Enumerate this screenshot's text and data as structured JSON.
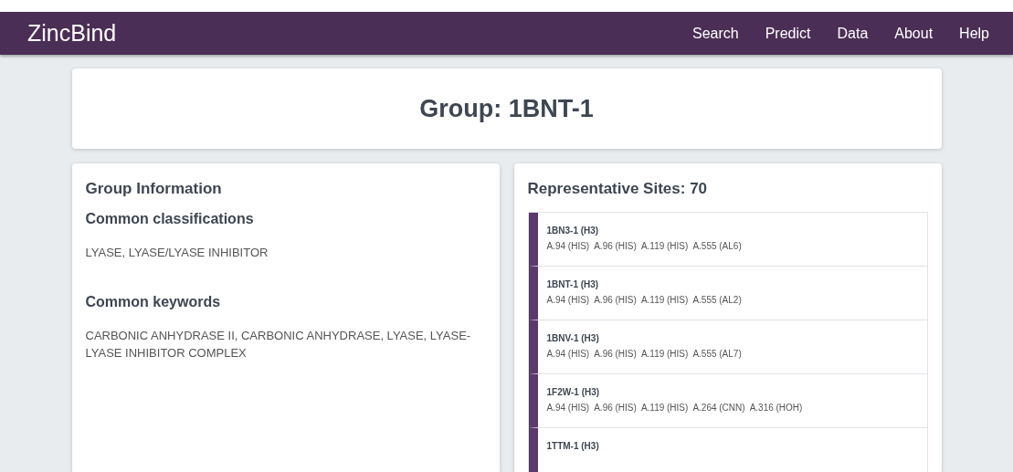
{
  "navbar": {
    "brand": "ZincBind",
    "links": [
      "Search",
      "Predict",
      "Data",
      "About",
      "Help"
    ]
  },
  "header": {
    "title": "Group: 1BNT-1"
  },
  "group_information": {
    "title": "Group Information",
    "sections": [
      {
        "heading": "Common classifications",
        "text": "LYASE, LYASE/LYASE INHIBITOR"
      },
      {
        "heading": "Common keywords",
        "text": "CARBONIC ANHYDRASE II, CARBONIC ANHYDRASE, LYASE, LYASE-LYASE INHIBITOR COMPLEX"
      }
    ]
  },
  "representative_sites": {
    "title": "Representative Sites: 70",
    "sites": [
      {
        "name": "1BN3-1 (H3)",
        "residues": [
          "A.94 (HIS)",
          "A.96 (HIS)",
          "A.119 (HIS)",
          "A.555 (AL6)"
        ]
      },
      {
        "name": "1BNT-1 (H3)",
        "residues": [
          "A.94 (HIS)",
          "A.96 (HIS)",
          "A.119 (HIS)",
          "A.555 (AL2)"
        ]
      },
      {
        "name": "1BNV-1 (H3)",
        "residues": [
          "A.94 (HIS)",
          "A.96 (HIS)",
          "A.119 (HIS)",
          "A.555 (AL7)"
        ]
      },
      {
        "name": "1F2W-1 (H3)",
        "residues": [
          "A.94 (HIS)",
          "A.96 (HIS)",
          "A.119 (HIS)",
          "A.264 (CNN)",
          "A.316 (HOH)"
        ]
      },
      {
        "name": "1TTM-1 (H3)"
      }
    ]
  }
}
